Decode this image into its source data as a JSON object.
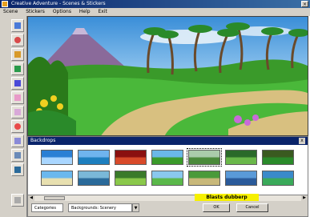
{
  "window": {
    "title": "Creative Adventure - Scenes & Stickers"
  },
  "menu": [
    "Scene",
    "Stickers",
    "Options",
    "Help",
    "Exit"
  ],
  "toolbar": {
    "tools": [
      "scene-tool-icon",
      "sticker-tool-icon",
      "paint-tool-icon",
      "stamp-tool-icon",
      "text-tool-icon",
      "eraser-tool-icon",
      "sound-tool-icon",
      "color-tool-icon",
      "shape-tool-icon",
      "undo-tool-icon",
      "print-tool-icon",
      "exit-tool-icon"
    ]
  },
  "backdrops_panel": {
    "title": "Backdrops",
    "close": "x",
    "highlight_label": "Blasts dubberp",
    "scroll_left": "◀",
    "scroll_right": "▶",
    "category_tab": "Categories",
    "category_select": "Backgrounds: Scenery",
    "dropdown_arrow": "▼",
    "ok_button": "OK",
    "cancel_button": "Cancel",
    "thumbnails": [
      {
        "name": "sky",
        "top": "#2a7fd4",
        "bottom": "#a9d6ff"
      },
      {
        "name": "ocean",
        "top": "#6fb4ee",
        "bottom": "#1d7fbf"
      },
      {
        "name": "red-rock",
        "top": "#8a1010",
        "bottom": "#d84a2a"
      },
      {
        "name": "meadow",
        "top": "#6ab8e8",
        "bottom": "#3a9a2a"
      },
      {
        "name": "field",
        "top": "#aaccaa",
        "bottom": "#4a8a3a"
      },
      {
        "name": "jungle",
        "top": "#2a6a2a",
        "bottom": "#6ab84a"
      },
      {
        "name": "forest",
        "top": "#3a5a20",
        "bottom": "#2a8a2a"
      },
      {
        "name": "beach",
        "top": "#6ab8ee",
        "bottom": "#e8e0b0"
      },
      {
        "name": "river",
        "top": "#7ab8d8",
        "bottom": "#2a6a9a"
      },
      {
        "name": "grass",
        "top": "#3a7a2a",
        "bottom": "#8ac84a"
      },
      {
        "name": "hills",
        "top": "#8ac8ee",
        "bottom": "#5ab84a"
      },
      {
        "name": "path",
        "top": "#4a9a3a",
        "bottom": "#c8b87a"
      },
      {
        "name": "lake",
        "top": "#5a9ad8",
        "bottom": "#2a5a9a"
      },
      {
        "name": "tropical",
        "top": "#3a8aca",
        "bottom": "#3aaa5a"
      }
    ]
  },
  "colors": {
    "sky": "#5aa8e8",
    "sky_light": "#cfe8f8",
    "grass": "#3aa82a",
    "path": "#d8c080",
    "volcano": "#8a6a9a"
  }
}
